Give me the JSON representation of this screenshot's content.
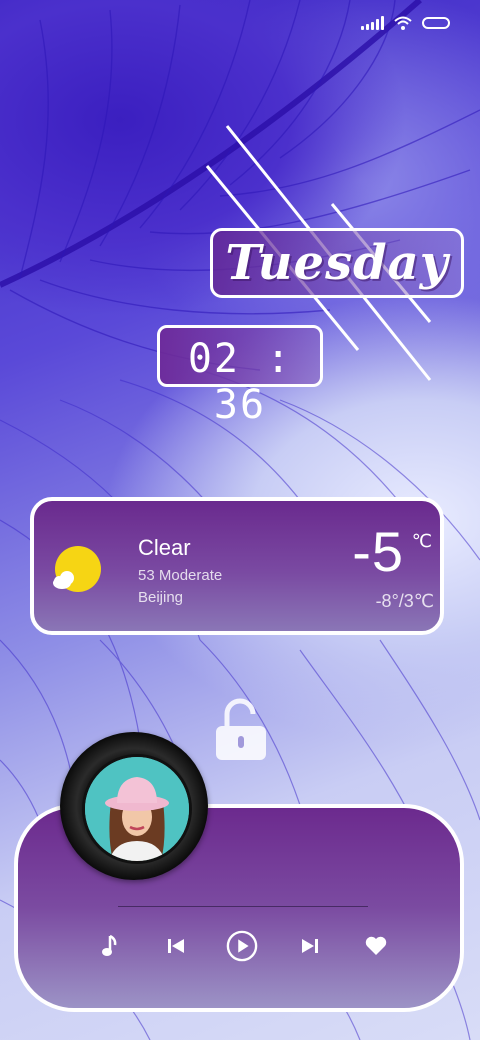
{
  "status_bar": {
    "icons": [
      "signal-icon",
      "wifi-icon",
      "battery-icon"
    ]
  },
  "clock": {
    "day": "Tuesday",
    "time": "02 : 36"
  },
  "weather": {
    "condition": "Clear",
    "air_quality": "53  Moderate",
    "city": "Beijing",
    "temperature": "-5",
    "unit": "℃",
    "range": "-8°/3℃",
    "icon": "sun-cloud-icon",
    "colors": {
      "sun": "#f6d514",
      "card_top": "#6a2a8e",
      "card_bottom": "#8a76b6"
    }
  },
  "lock": {
    "icon": "unlock-icon"
  },
  "music": {
    "album_art": "woman-pink-hat-portrait",
    "controls": [
      "note-icon",
      "previous-icon",
      "play-icon",
      "next-icon",
      "heart-icon"
    ]
  }
}
